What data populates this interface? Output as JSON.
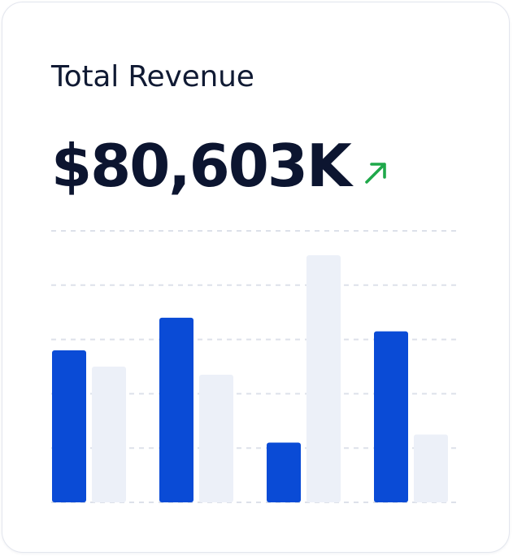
{
  "card": {
    "title": "Total Revenue",
    "value": "$80,603K",
    "trend_icon": "arrow-up-right-icon",
    "trend": "up"
  },
  "colors": {
    "primary_bar": "#0a4bd6",
    "secondary_bar": "#ecf0f8",
    "trend_up": "#1fa84a",
    "gridline": "#dde1ea"
  },
  "chart_data": {
    "type": "bar",
    "title": "",
    "xlabel": "",
    "ylabel": "",
    "ylim": [
      0,
      100
    ],
    "grid": true,
    "legend": "none",
    "categories": [
      "",
      "",
      "",
      ""
    ],
    "series": [
      {
        "values": [
          56,
          68,
          22,
          63
        ]
      },
      {
        "values": [
          50,
          47,
          91,
          25
        ]
      }
    ]
  }
}
